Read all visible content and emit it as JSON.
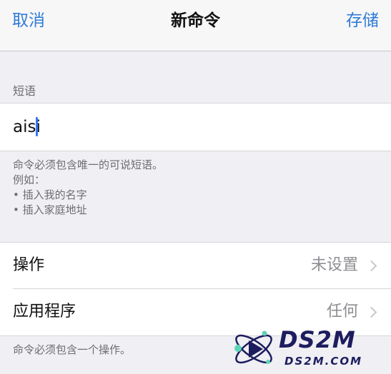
{
  "nav": {
    "cancel_label": "取消",
    "title": "新命令",
    "save_label": "存储"
  },
  "phrase_section": {
    "header": "短语",
    "input_value": "aisi",
    "footer_lines": [
      "命令必须包含唯一的可说短语。",
      "例如：",
      "• 插入我的名字",
      "• 插入家庭地址"
    ]
  },
  "settings_section": {
    "rows": [
      {
        "label": "操作",
        "value": "未设置",
        "icon": "chevron-right-icon"
      },
      {
        "label": "应用程序",
        "value": "任何",
        "icon": "chevron-right-icon"
      }
    ],
    "footer": "命令必须包含一个操作。"
  },
  "watermark": {
    "title": "DS2M",
    "subtitle": "DS2M.COM"
  },
  "colors": {
    "accent": "#2f7bd7",
    "background": "#efeff4",
    "secondary_text": "#6d6d72",
    "value_text": "#8e8e93",
    "caret": "#3478f6"
  }
}
